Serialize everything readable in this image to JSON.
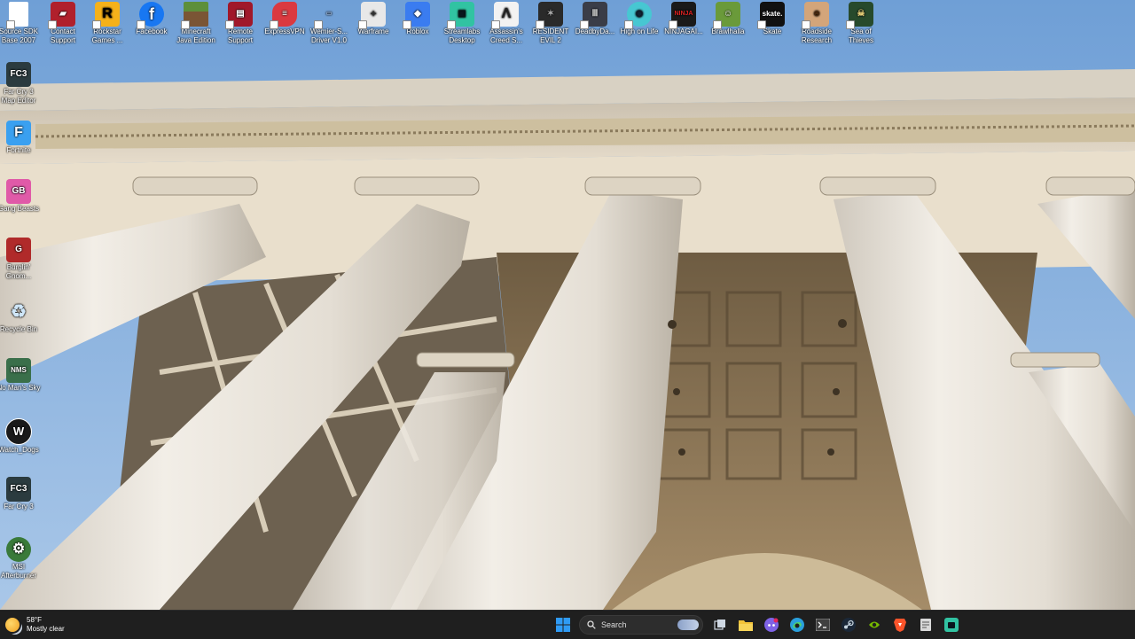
{
  "desktop": {
    "top_icons": [
      {
        "label": "Source SDK Base 2007",
        "icon": "document-icon",
        "color": "#ffffff"
      },
      {
        "label": "Contact Support",
        "icon": "chat-support-icon",
        "color": "#b0202c"
      },
      {
        "label": "Rockstar Games ...",
        "icon": "rockstar-icon",
        "color": "#f5b11a"
      },
      {
        "label": "Facebook",
        "icon": "facebook-icon",
        "color": "#1877f2"
      },
      {
        "label": "Minecraft Java Edition",
        "icon": "minecraft-icon",
        "color": "#5d8f3a"
      },
      {
        "label": "Remote Support",
        "icon": "remote-support-icon",
        "color": "#a0182a"
      },
      {
        "label": "ExpressVPN",
        "icon": "expressvpn-icon",
        "color": "#da3940"
      },
      {
        "label": "Wemier-S... Driver V1.0",
        "icon": "driver-icon",
        "color": "#9ab4d8"
      },
      {
        "label": "Warframe",
        "icon": "warframe-icon",
        "color": "#e8e8e8"
      },
      {
        "label": "Roblox",
        "icon": "roblox-icon",
        "color": "#3a7cf0"
      },
      {
        "label": "Streamlabs Desktop",
        "icon": "streamlabs-icon",
        "color": "#31c3a2"
      },
      {
        "label": "Assassin's Creed S...",
        "icon": "assassins-creed-icon",
        "color": "#f2f2f2"
      },
      {
        "label": "RESIDENT EVIL 2",
        "icon": "resident-evil-icon",
        "color": "#2a2a2a"
      },
      {
        "label": "DeadbyDa...",
        "icon": "dead-by-daylight-icon",
        "color": "#3a3d48"
      },
      {
        "label": "High on Life",
        "icon": "high-on-life-icon",
        "color": "#47c7d2"
      },
      {
        "label": "NINJAGAI...",
        "icon": "ninja-gaiden-icon",
        "color": "#1a1a1a"
      },
      {
        "label": "Brawlhalla",
        "icon": "brawlhalla-icon",
        "color": "#6a9a3a"
      },
      {
        "label": "Skate",
        "icon": "skate-icon",
        "color": "#111111"
      },
      {
        "label": "Roadside Research",
        "icon": "roadside-research-icon",
        "color": "#d3a57a"
      },
      {
        "label": "Sea of Thieves",
        "icon": "sea-of-thieves-icon",
        "color": "#274a2c"
      }
    ],
    "left_icons": [
      {
        "label": "Far Cry 3 Map Editor",
        "icon": "far-cry-3-editor-icon",
        "text": "FC3",
        "color": "#2b3b3f"
      },
      {
        "label": "Fortnite",
        "icon": "fortnite-icon",
        "text": "F",
        "color": "#3aa0f0"
      },
      {
        "label": "Gang Beasts",
        "icon": "gang-beasts-icon",
        "text": "GB",
        "color": "#e05aa8"
      },
      {
        "label": "Burglin' Gnom...",
        "icon": "burglin-gnomes-icon",
        "text": "G",
        "color": "#b02a2a"
      },
      {
        "label": "Recycle Bin",
        "icon": "recycle-bin-icon",
        "text": "♻",
        "color": "#7fb6e0"
      },
      {
        "label": "No Man's Sky",
        "icon": "no-mans-sky-icon",
        "text": "NMS",
        "color": "#3a6f4a"
      },
      {
        "label": "Watch_Dogs",
        "icon": "watch-dogs-icon",
        "text": "W",
        "color": "#1a1a1a"
      },
      {
        "label": "Far Cry 3",
        "icon": "far-cry-3-icon",
        "text": "FC3",
        "color": "#2b3b3f"
      },
      {
        "label": "MSI Afterburner",
        "icon": "msi-afterburner-icon",
        "text": "⚙",
        "color": "#3a7a3a"
      }
    ]
  },
  "taskbar": {
    "weather": {
      "temp": "58°F",
      "condition": "Mostly clear"
    },
    "search_label": "Search",
    "pinned": [
      {
        "name": "start-button",
        "icon": "windows-logo-icon",
        "color": "#2f9bf5"
      },
      {
        "name": "search-box",
        "icon": "search-icon"
      },
      {
        "name": "task-view-button",
        "icon": "task-view-icon",
        "color": "#cfd8e3"
      },
      {
        "name": "file-explorer-button",
        "icon": "folder-icon",
        "color": "#f3c338"
      },
      {
        "name": "discord-button",
        "icon": "discord-icon",
        "color": "#7e63e6"
      },
      {
        "name": "edge-button",
        "icon": "edge-icon",
        "color": "#2a9fdc"
      },
      {
        "name": "terminal-button",
        "icon": "terminal-icon",
        "color": "#404040"
      },
      {
        "name": "steam-button",
        "icon": "steam-icon",
        "color": "#1b2838"
      },
      {
        "name": "nvidia-button",
        "icon": "nvidia-icon",
        "color": "#76b900"
      },
      {
        "name": "brave-button",
        "icon": "brave-icon",
        "color": "#fb542b"
      },
      {
        "name": "notepad-button",
        "icon": "notepad-icon",
        "color": "#d9d9d9"
      },
      {
        "name": "streamlabs-button",
        "icon": "streamlabs-icon",
        "color": "#31c3a2"
      }
    ]
  }
}
